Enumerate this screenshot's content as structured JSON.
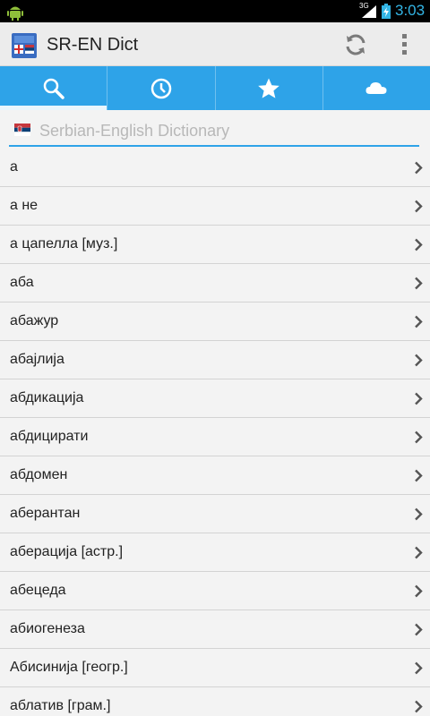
{
  "status_bar": {
    "network": "3G",
    "time": "3:03",
    "icons": [
      "android-robot-icon",
      "signal-icon",
      "battery-charging-icon"
    ]
  },
  "app": {
    "title": "SR-EN Dict",
    "icons": [
      "app-icon",
      "refresh-icon",
      "overflow-menu-icon"
    ]
  },
  "tabs": [
    {
      "id": "search",
      "icon": "search-icon",
      "active": true
    },
    {
      "id": "history",
      "icon": "clock-icon",
      "active": false
    },
    {
      "id": "favorites",
      "icon": "star-icon",
      "active": false
    },
    {
      "id": "cloud",
      "icon": "cloud-icon",
      "active": false
    }
  ],
  "search": {
    "placeholder": "Serbian-English Dictionary",
    "value": "",
    "flag_icon": "serbia-flag-icon"
  },
  "colors": {
    "accent": "#2ea3e8",
    "clock": "#33b5e5",
    "background": "#f3f3f3"
  },
  "words": [
    "а",
    "а не",
    "а цапелла [муз.]",
    "аба",
    "абажур",
    "абајлија",
    "абдикација",
    "абдицирати",
    "абдомен",
    "аберантан",
    "аберација [астр.]",
    "абецеда",
    "абиогенеза",
    "Абисинија [геогр.]",
    "аблатив [грам.]"
  ]
}
